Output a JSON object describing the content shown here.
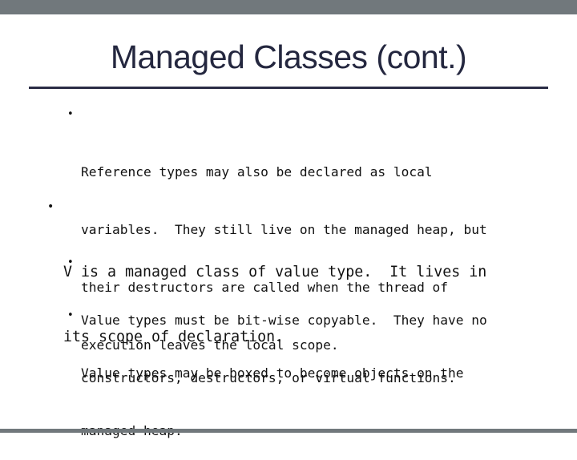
{
  "slide": {
    "title": "Managed Classes (cont.)",
    "bullet_glyph": "•",
    "bullets": [
      {
        "level": 2,
        "lines": [
          "Reference types may also be declared as local",
          "variables.  They still live on the managed heap, but",
          "their destructors are called when the thread of",
          "execution leaves the local scope."
        ]
      },
      {
        "level": 1,
        "lines": [
          "V is a managed class of value type.  It lives in",
          "its scope of declaration."
        ]
      },
      {
        "level": 2,
        "lines": [
          "Value types must be bit-wise copyable.  They have no",
          "constructors, destructors, or virtual functions."
        ]
      },
      {
        "level": 2,
        "lines": [
          "Value types may be boxed to become objects on the",
          "managed heap."
        ]
      }
    ]
  },
  "colors": {
    "frame_bar": "#71787c",
    "title_text": "#24273f",
    "title_rule": "#2a2c45",
    "body_text": "#111111"
  }
}
